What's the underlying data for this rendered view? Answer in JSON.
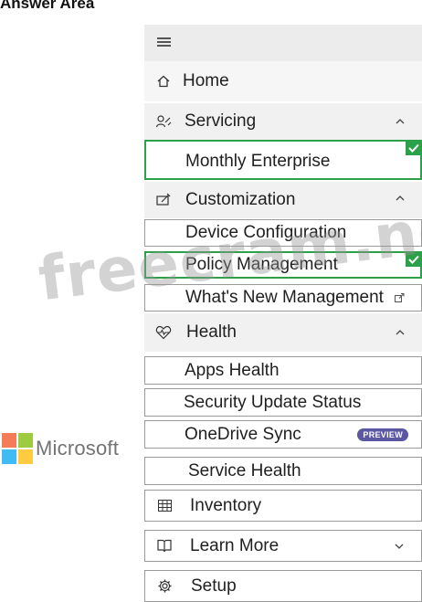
{
  "header": {
    "title": "Answer Area"
  },
  "brand": {
    "name": "Microsoft",
    "colors": [
      "#f25022",
      "#7fba00",
      "#00a4ef",
      "#ffb900"
    ]
  },
  "watermark": "freecram.net",
  "accent": {
    "selected": "#2da14a",
    "badge": "#5c57a3"
  },
  "nav": {
    "menu_icon": "hamburger-icon",
    "home": {
      "label": "Home",
      "icon": "home-icon"
    },
    "servicing": {
      "label": "Servicing",
      "icon": "servicing-icon",
      "expanded": true,
      "items": [
        {
          "label": "Monthly Enterprise",
          "selected": true
        }
      ]
    },
    "customization": {
      "label": "Customization",
      "icon": "customization-icon",
      "expanded": true,
      "items": [
        {
          "label": "Device Configuration",
          "selected": false
        },
        {
          "label": "Policy Management",
          "selected": true
        },
        {
          "label": "What's New Management",
          "selected": false,
          "icon": "external-link-icon"
        }
      ]
    },
    "health": {
      "label": "Health",
      "icon": "health-icon",
      "expanded": true,
      "items": [
        {
          "label": "Apps Health"
        },
        {
          "label": "Security Update Status"
        },
        {
          "label": "OneDrive Sync",
          "badge": "PREVIEW"
        },
        {
          "label": "Service Health"
        }
      ]
    },
    "inventory": {
      "label": "Inventory",
      "icon": "inventory-icon"
    },
    "learn_more": {
      "label": "Learn More",
      "icon": "book-icon",
      "expanded": false
    },
    "setup": {
      "label": "Setup",
      "icon": "gear-icon"
    }
  }
}
